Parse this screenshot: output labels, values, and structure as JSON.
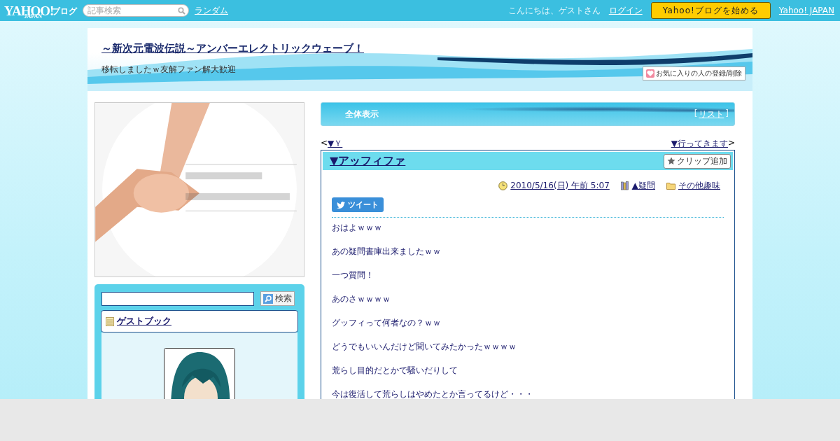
{
  "topbar": {
    "logo": "YAHOO!",
    "logo_sub": "JAPAN",
    "logo_service": "ブログ",
    "search": {
      "placeholder": "記事検索"
    },
    "random_link": "ランダム",
    "greeting": "こんにちは、ゲストさん",
    "login_link": "ログイン",
    "start_button": "Yahoo!ブログを始める",
    "yahoo_link": "Yahoo! JAPAN"
  },
  "blog": {
    "title": "～新次元電波伝説～アンバーエレクトリックウェーブ！",
    "description": "移転しましたｗ友解ファン解大歓迎",
    "favorite_button": "お気に入りの人の登録/削除"
  },
  "sidebar": {
    "search_button": "検索",
    "guestbook_link": "ゲストブック"
  },
  "main": {
    "header": {
      "title": "全体表示",
      "list_open": "[",
      "list_link": "リスト",
      "list_close": "]"
    },
    "nav": {
      "prev_mark": "<",
      "prev_link": "▼Ｙ",
      "next_link": "▼行ってきます",
      "next_mark": ">"
    },
    "post": {
      "title": "▼アッフィファ",
      "clip_button": "クリップ追加",
      "date": "2010/5/16(日) 午前 5:07",
      "category": "▲疑問",
      "folder": "その他趣味",
      "tweet_button": "ツイート",
      "paragraphs": [
        "おはよｗｗｗ",
        "あの疑問書庫出来ましたｗｗ",
        "一つ質問！",
        "あのさｗｗｗｗ",
        "グッフィって何者なの？ｗｗ",
        "どうでもいいんだけど聞いてみたかったｗｗｗｗ",
        "荒らし目的だとかで騒いだりして",
        "今は復活して荒らしはやめたとか言ってるけど・・・"
      ]
    }
  }
}
